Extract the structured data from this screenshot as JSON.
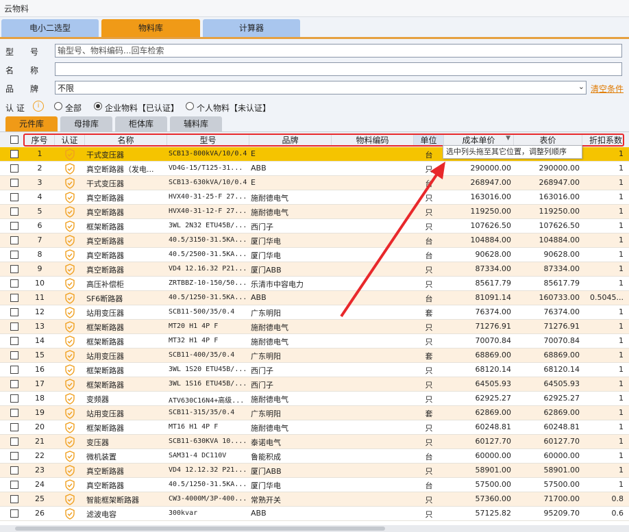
{
  "window": {
    "title": "云物料"
  },
  "main_tabs": [
    {
      "label": "电小二选型",
      "active": false
    },
    {
      "label": "物料库",
      "active": true
    },
    {
      "label": "计算器",
      "active": false
    }
  ],
  "filters": {
    "model": {
      "label_a": "型",
      "label_b": "号",
      "placeholder": "输型号、物料编码...回车检索",
      "value": ""
    },
    "name": {
      "label_a": "名",
      "label_b": "称",
      "value": ""
    },
    "brand": {
      "label_a": "品",
      "label_b": "牌",
      "value": "不限"
    },
    "clear_label": "清空条件"
  },
  "certification": {
    "label": "认 证",
    "info_icon": "i",
    "options": [
      {
        "label": "全部",
        "selected": false
      },
      {
        "label": "企业物料【已认证】",
        "selected": true
      },
      {
        "label": "个人物料【未认证】",
        "selected": false
      }
    ]
  },
  "sub_tabs": [
    {
      "label": "元件库",
      "active": true
    },
    {
      "label": "母排库",
      "active": false
    },
    {
      "label": "柜体库",
      "active": false
    },
    {
      "label": "辅料库",
      "active": false
    }
  ],
  "table": {
    "columns": [
      "序号",
      "认证",
      "名称",
      "型号",
      "品牌",
      "物料编码",
      "单位",
      "成本单价",
      "表价",
      "折扣系数"
    ],
    "rows": [
      {
        "seq": "1",
        "name": "干式变压器",
        "model": "SCB13-800kVA/10/0.4",
        "brand": "E",
        "code": "",
        "unit": "台",
        "cost": "",
        "list": "",
        "discount": "1"
      },
      {
        "seq": "2",
        "name": "真空断路器（发电...",
        "model": "VD4G-15/T125-31...",
        "brand": "ABB",
        "code": "",
        "unit": "只",
        "cost": "290000.00",
        "list": "290000.00",
        "discount": "1"
      },
      {
        "seq": "3",
        "name": "干式变压器",
        "model": "SCB13-630kVA/10/0.4",
        "brand": "E",
        "code": "",
        "unit": "台",
        "cost": "268947.00",
        "list": "268947.00",
        "discount": "1"
      },
      {
        "seq": "4",
        "name": "真空断路器",
        "model": "HVX40-31-25-F 27...",
        "brand": "施耐德电气",
        "code": "",
        "unit": "只",
        "cost": "163016.00",
        "list": "163016.00",
        "discount": "1"
      },
      {
        "seq": "5",
        "name": "真空断路器",
        "model": "HVX40-31-12-F 27...",
        "brand": "施耐德电气",
        "code": "",
        "unit": "只",
        "cost": "119250.00",
        "list": "119250.00",
        "discount": "1"
      },
      {
        "seq": "6",
        "name": "框架断路器",
        "model": "3WL 2N32 ETU45B/...",
        "brand": "西门子",
        "code": "",
        "unit": "只",
        "cost": "107626.50",
        "list": "107626.50",
        "discount": "1"
      },
      {
        "seq": "7",
        "name": "真空断路器",
        "model": "40.5/3150-31.5KA...",
        "brand": "厦门华电",
        "code": "",
        "unit": "台",
        "cost": "104884.00",
        "list": "104884.00",
        "discount": "1"
      },
      {
        "seq": "8",
        "name": "真空断路器",
        "model": "40.5/2500-31.5KA...",
        "brand": "厦门华电",
        "code": "",
        "unit": "台",
        "cost": "90628.00",
        "list": "90628.00",
        "discount": "1"
      },
      {
        "seq": "9",
        "name": "真空断路器",
        "model": "VD4 12.16.32 P21...",
        "brand": "厦门ABB",
        "code": "",
        "unit": "只",
        "cost": "87334.00",
        "list": "87334.00",
        "discount": "1"
      },
      {
        "seq": "10",
        "name": "高压补偿柜",
        "model": "ZRTBBZ-10-150/50...",
        "brand": "乐清市中容电力",
        "code": "",
        "unit": "只",
        "cost": "85617.79",
        "list": "85617.79",
        "discount": "1"
      },
      {
        "seq": "11",
        "name": "SF6断路器",
        "model": "40.5/1250-31.5KA...",
        "brand": "ABB",
        "code": "",
        "unit": "台",
        "cost": "81091.14",
        "list": "160733.00",
        "discount": "0.5045..."
      },
      {
        "seq": "12",
        "name": "站用变压器",
        "model": "SCB11-500/35/0.4",
        "brand": "广东明阳",
        "code": "",
        "unit": "套",
        "cost": "76374.00",
        "list": "76374.00",
        "discount": "1"
      },
      {
        "seq": "13",
        "name": "框架断路器",
        "model": "MT20 H1 4P F",
        "brand": "施耐德电气",
        "code": "",
        "unit": "只",
        "cost": "71276.91",
        "list": "71276.91",
        "discount": "1"
      },
      {
        "seq": "14",
        "name": "框架断路器",
        "model": "MT32 H1 4P F",
        "brand": "施耐德电气",
        "code": "",
        "unit": "只",
        "cost": "70070.84",
        "list": "70070.84",
        "discount": "1"
      },
      {
        "seq": "15",
        "name": "站用变压器",
        "model": "SCB11-400/35/0.4",
        "brand": "广东明阳",
        "code": "",
        "unit": "套",
        "cost": "68869.00",
        "list": "68869.00",
        "discount": "1"
      },
      {
        "seq": "16",
        "name": "框架断路器",
        "model": "3WL 1S20 ETU45B/...",
        "brand": "西门子",
        "code": "",
        "unit": "只",
        "cost": "68120.14",
        "list": "68120.14",
        "discount": "1"
      },
      {
        "seq": "17",
        "name": "框架断路器",
        "model": "3WL 1S16 ETU45B/...",
        "brand": "西门子",
        "code": "",
        "unit": "只",
        "cost": "64505.93",
        "list": "64505.93",
        "discount": "1"
      },
      {
        "seq": "18",
        "name": "变频器",
        "model": "ATV630C16N4+高级...",
        "brand": "施耐德电气",
        "code": "",
        "unit": "只",
        "cost": "62925.27",
        "list": "62925.27",
        "discount": "1"
      },
      {
        "seq": "19",
        "name": "站用变压器",
        "model": "SCB11-315/35/0.4",
        "brand": "广东明阳",
        "code": "",
        "unit": "套",
        "cost": "62869.00",
        "list": "62869.00",
        "discount": "1"
      },
      {
        "seq": "20",
        "name": "框架断路器",
        "model": "MT16 H1 4P F",
        "brand": "施耐德电气",
        "code": "",
        "unit": "只",
        "cost": "60248.81",
        "list": "60248.81",
        "discount": "1"
      },
      {
        "seq": "21",
        "name": "变压器",
        "model": "SCB11-630KVA 10....",
        "brand": "泰诺电气",
        "code": "",
        "unit": "只",
        "cost": "60127.70",
        "list": "60127.70",
        "discount": "1"
      },
      {
        "seq": "22",
        "name": "微机装置",
        "model": "SAM31-4 DC110V",
        "brand": "鲁能积成",
        "code": "",
        "unit": "台",
        "cost": "60000.00",
        "list": "60000.00",
        "discount": "1"
      },
      {
        "seq": "23",
        "name": "真空断路器",
        "model": "VD4 12.12.32 P21...",
        "brand": "厦门ABB",
        "code": "",
        "unit": "只",
        "cost": "58901.00",
        "list": "58901.00",
        "discount": "1"
      },
      {
        "seq": "24",
        "name": "真空断路器",
        "model": "40.5/1250-31.5KA...",
        "brand": "厦门华电",
        "code": "",
        "unit": "台",
        "cost": "57500.00",
        "list": "57500.00",
        "discount": "1"
      },
      {
        "seq": "25",
        "name": "智能框架断路器",
        "model": "CW3-4000M/3P-400...",
        "brand": "常熟开关",
        "code": "",
        "unit": "只",
        "cost": "57360.00",
        "list": "71700.00",
        "discount": "0.8"
      },
      {
        "seq": "26",
        "name": "滤波电容",
        "model": "300kvar",
        "brand": "ABB",
        "code": "",
        "unit": "只",
        "cost": "57125.82",
        "list": "95209.70",
        "discount": "0.6"
      }
    ]
  },
  "tooltip": {
    "text": "选中列头拖至其它位置，调整列顺序"
  },
  "colors": {
    "accent": "#f09a17",
    "tab_inactive": "#a9c6ee",
    "row_alt": "#fdf0e0",
    "row_selected": "#f5c400",
    "annotation_red": "#e8282b",
    "shield": "#f0a020"
  },
  "icons": {
    "cert": "shield-check-icon",
    "info": "info-icon",
    "dropdown": "chevron-down-icon",
    "arrow": "red-arrow-annotation"
  }
}
